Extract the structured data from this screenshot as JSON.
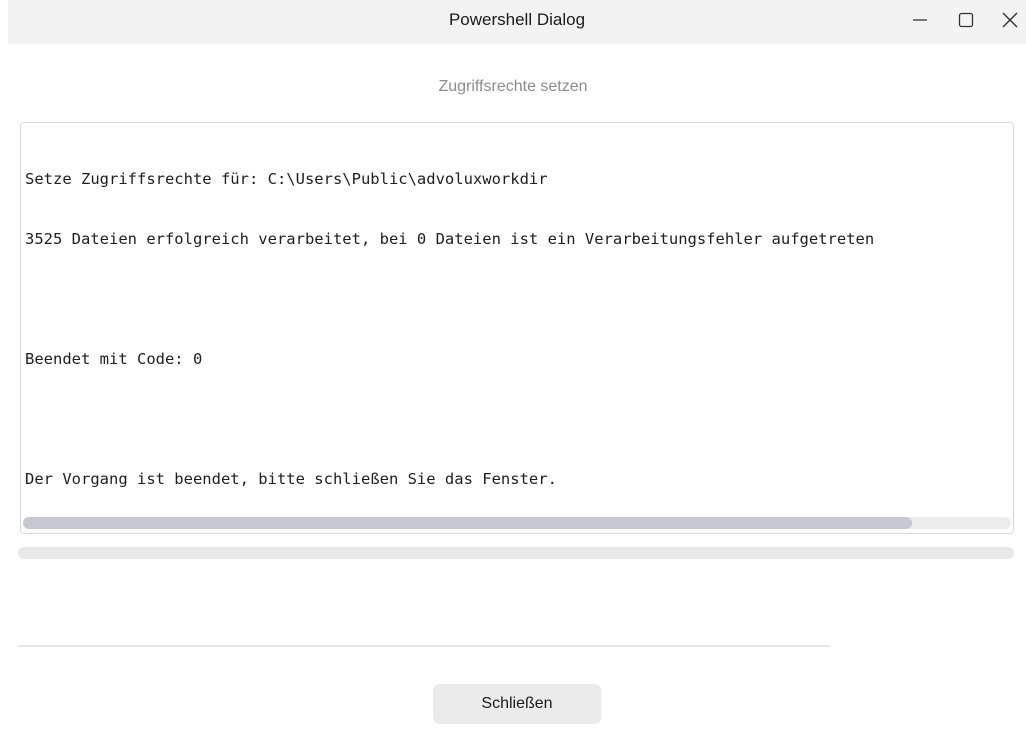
{
  "window": {
    "title": "Powershell Dialog",
    "controls": {
      "minimize_icon": "minimize-icon",
      "maximize_icon": "maximize-icon",
      "close_icon": "close-icon"
    }
  },
  "header": {
    "subtitle": "Zugriffsrechte setzen"
  },
  "console": {
    "lines": [
      "Setze Zugriffsrechte für: C:\\Users\\Public\\advoluxworkdir",
      "3525 Dateien erfolgreich verarbeitet, bei 0 Dateien ist ein Verarbeitungsfehler aufgetreten",
      "",
      "Beendet mit Code: 0",
      "",
      "Der Vorgang ist beendet, bitte schließen Sie das Fenster."
    ],
    "horizontal_scroll_fraction": 0.9
  },
  "progress": {
    "value_fraction": 0.0
  },
  "footer": {
    "close_label": "Schließen"
  },
  "colors": {
    "titlebar_bg": "#f3f3f3",
    "subtitle": "#8c8c8c",
    "scroll_thumb": "#c7c9d2",
    "button_bg": "#ebebeb"
  }
}
